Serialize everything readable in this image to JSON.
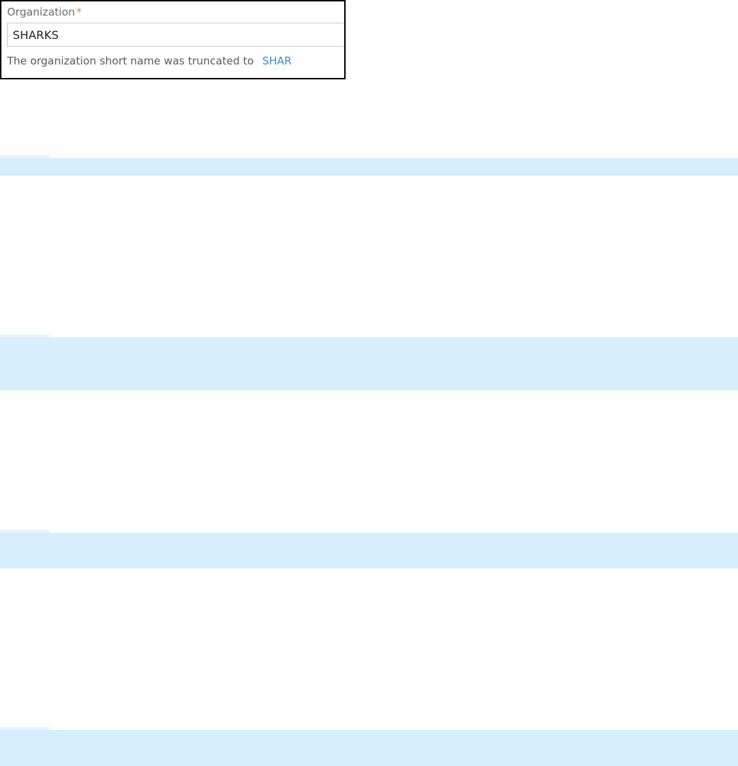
{
  "organization_field": {
    "label": "Organization",
    "required_marker": "*",
    "value": "SHARKS",
    "hint_text": "The organization short name was truncated to",
    "hint_value": "SHAR"
  },
  "colors": {
    "required_star": "#e0852b",
    "hint_value": "#3c87d6",
    "band_background": "#d6eefb"
  }
}
